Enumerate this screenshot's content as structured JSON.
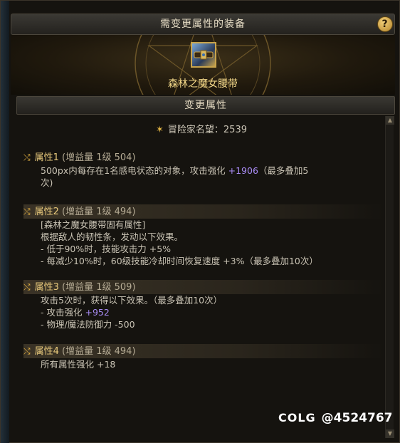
{
  "window": {
    "title": "需变更属性的装备",
    "help_label": "?"
  },
  "equipment": {
    "name": "森林之魔女腰带",
    "icon": "belt-icon"
  },
  "section": {
    "title": "变更属性"
  },
  "reputation": {
    "icon": "laurel-icon",
    "text": "冒险家名望：2539"
  },
  "attributes": [
    {
      "title": "属性1",
      "meta": "(增益量 1级 504)",
      "lines": [
        {
          "text": "500px内每存在1名感电状态的对象，攻击强化 ",
          "highlight": "+1906",
          "suffix": "（最多叠加5"
        },
        {
          "text": "次)"
        }
      ]
    },
    {
      "title": "属性2",
      "meta": "(增益量 1级 494)",
      "lines": [
        {
          "text": "[森林之魔女腰带固有属性]"
        },
        {
          "text": "根据敌人的韧性条，发动以下效果。"
        },
        {
          "text": "- 低于90%时，技能攻击力 +5%"
        },
        {
          "text": "- 每减少10%时，60级技能冷却时间恢复速度 +3%（最多叠加10次）"
        }
      ]
    },
    {
      "title": "属性3",
      "meta": "(增益量 1级 509)",
      "lines": [
        {
          "text": "攻击5次时，获得以下效果。（最多叠加10次）"
        },
        {
          "text": "- 攻击强化 ",
          "highlight": "+952"
        },
        {
          "text": "- 物理/魔法防御力 -500"
        }
      ]
    },
    {
      "title": "属性4",
      "meta": "(增益量 1级 494)",
      "lines": [
        {
          "text": "所有属性强化 +18"
        }
      ]
    }
  ],
  "watermark": {
    "logo": "COLG",
    "handle": "@4524767"
  },
  "colors": {
    "accent_gold": "#e8c97c",
    "highlight_purple": "#a98cf5",
    "name_gold": "#f4d98a"
  }
}
